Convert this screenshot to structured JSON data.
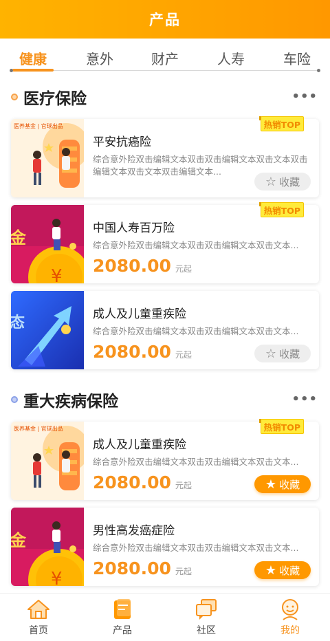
{
  "header": {
    "title": "产品"
  },
  "tabs": [
    {
      "label": "健康",
      "active": true
    },
    {
      "label": "意外",
      "active": false
    },
    {
      "label": "财产",
      "active": false
    },
    {
      "label": "人寿",
      "active": false
    },
    {
      "label": "车险",
      "active": false
    }
  ],
  "sections": [
    {
      "title": "医疗保险",
      "more": "•••",
      "dot_color": "#f7a24a"
    },
    {
      "title": "重大疾病保险",
      "more": "•••",
      "dot_color": "#8aa0e8"
    }
  ],
  "cards": [
    {
      "title": "平安抗癌险",
      "desc": "综合意外险双击编辑文本双击双击编辑文本双击文本双击编辑文本双击文本双击编辑文本...",
      "price": "",
      "unit": "",
      "fav": "收藏",
      "fav_active": false,
      "hot": "热销TOP",
      "thumb_badge": "医养基金 | 官球出品"
    },
    {
      "title": "中国人寿百万险",
      "desc": "综合意外险双击编辑文本双击双击编辑文本双击文本...",
      "price": "2080.00",
      "unit": "元起",
      "fav": "",
      "fav_active": false,
      "hot": "热销TOP",
      "thumb_text": "金"
    },
    {
      "title": "成人及儿童重疾险",
      "desc": "综合意外险双击编辑文本双击双击编辑文本双击文本...",
      "price": "2080.00",
      "unit": "元起",
      "fav": "收藏",
      "fav_active": false,
      "hot": "",
      "thumb_text": "态"
    },
    {
      "title": "成人及儿童重疾险",
      "desc": "综合意外险双击编辑文本双击双击编辑文本双击文本...",
      "price": "2080.00",
      "unit": "元起",
      "fav": "收藏",
      "fav_active": true,
      "hot": "热销TOP",
      "thumb_badge": "医养基金 | 官球出品"
    },
    {
      "title": "男性高发癌症险",
      "desc": "综合意外险双击编辑文本双击双击编辑文本双击文本...",
      "price": "2080.00",
      "unit": "元起",
      "fav": "收藏",
      "fav_active": true,
      "hot": "",
      "thumb_text": "金"
    }
  ],
  "tabbar": [
    {
      "label": "首页",
      "icon": "home-icon",
      "active": false
    },
    {
      "label": "产品",
      "icon": "product-icon",
      "active": false
    },
    {
      "label": "社区",
      "icon": "community-icon",
      "active": false
    },
    {
      "label": "我的",
      "icon": "profile-icon",
      "active": true
    }
  ],
  "colors": {
    "brand": "#ff9800",
    "accent": "#f7931e",
    "hot_bg": "#ffeb3b"
  }
}
